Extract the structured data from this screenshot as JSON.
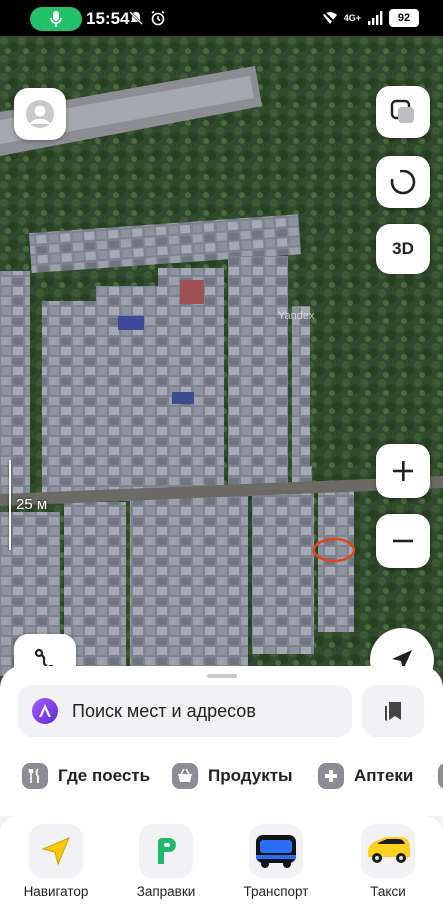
{
  "status_bar": {
    "time": "15:54",
    "network": "4G+",
    "battery": "92"
  },
  "map": {
    "scale_label": "25 м",
    "watermark": "Yandex",
    "btn_3d": "3D"
  },
  "search": {
    "placeholder": "Поиск мест и адресов"
  },
  "chips": [
    {
      "label": "Где поесть",
      "icon": "fork-knife-icon"
    },
    {
      "label": "Продукты",
      "icon": "basket-icon"
    },
    {
      "label": "Аптеки",
      "icon": "plus-cross-icon"
    }
  ],
  "apps": [
    {
      "label": "Навигатор",
      "icon": "navigator-arrow-icon"
    },
    {
      "label": "Заправки",
      "icon": "fuel-station-icon"
    },
    {
      "label": "Транспорт",
      "icon": "bus-icon"
    },
    {
      "label": "Такси",
      "icon": "taxi-car-icon"
    }
  ],
  "colors": {
    "mic_indicator": "#24c06a",
    "alice": "#7b3cf0",
    "navigator": "#f6c90e",
    "fuel": "#1db86c",
    "bus": "#2a6ef3",
    "taxi": "#fcd21c",
    "marker": "#e2441d"
  }
}
